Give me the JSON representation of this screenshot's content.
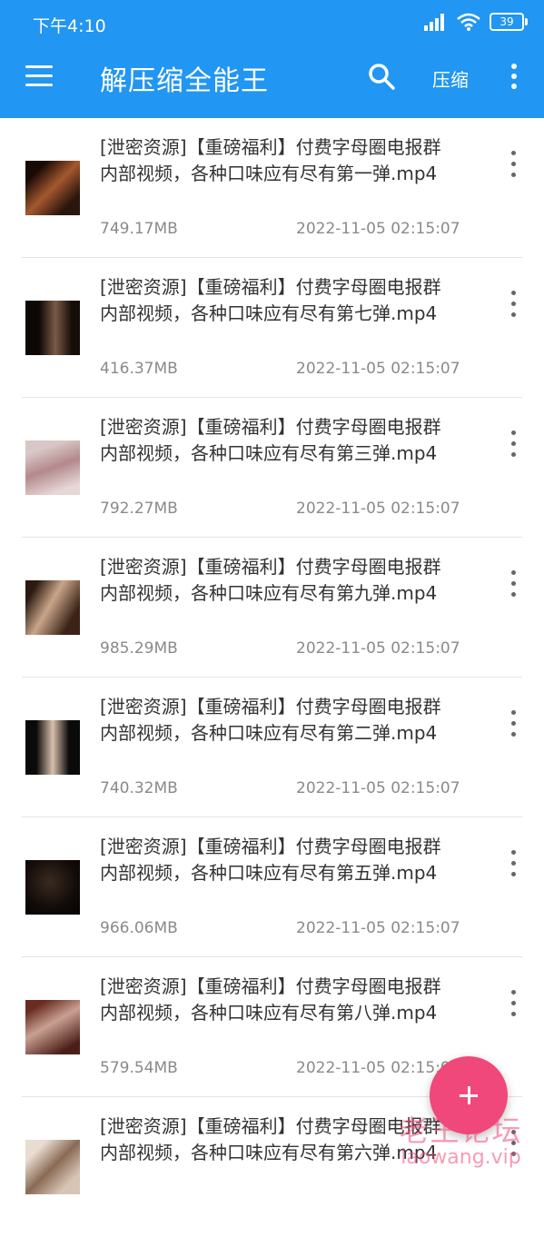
{
  "status_bar": {
    "time": "下午4:10",
    "battery": "39"
  },
  "app_bar": {
    "title": "解压缩全能王",
    "compress_label": "压缩"
  },
  "files": [
    {
      "title": "[泄密资源]【重磅福利】付费字母圈电报群内部视频，各种口味应有尽有第一弹.mp4",
      "size": "749.17MB",
      "date": "2022-11-05 02:15:07"
    },
    {
      "title": "[泄密资源]【重磅福利】付费字母圈电报群内部视频，各种口味应有尽有第七弹.mp4",
      "size": "416.37MB",
      "date": "2022-11-05 02:15:07"
    },
    {
      "title": "[泄密资源]【重磅福利】付费字母圈电报群内部视频，各种口味应有尽有第三弹.mp4",
      "size": "792.27MB",
      "date": "2022-11-05 02:15:07"
    },
    {
      "title": "[泄密资源]【重磅福利】付费字母圈电报群内部视频，各种口味应有尽有第九弹.mp4",
      "size": "985.29MB",
      "date": "2022-11-05 02:15:07"
    },
    {
      "title": "[泄密资源]【重磅福利】付费字母圈电报群内部视频，各种口味应有尽有第二弹.mp4",
      "size": "740.32MB",
      "date": "2022-11-05 02:15:07"
    },
    {
      "title": "[泄密资源]【重磅福利】付费字母圈电报群内部视频，各种口味应有尽有第五弹.mp4",
      "size": "966.06MB",
      "date": "2022-11-05 02:15:07"
    },
    {
      "title": "[泄密资源]【重磅福利】付费字母圈电报群内部视频，各种口味应有尽有第八弹.mp4",
      "size": "579.54MB",
      "date": "2022-11-05 02:15:07"
    },
    {
      "title": "[泄密资源]【重磅福利】付费字母圈电报群内部视频，各种口味应有尽有第六弹.mp4",
      "size": "",
      "date": ""
    }
  ],
  "watermark": {
    "line1": "老王论坛",
    "line2": "laowang.vip"
  },
  "colors": {
    "primary": "#2196F3",
    "fab": "#F0487A"
  },
  "icons": [
    "signal-icon",
    "wifi-icon",
    "battery-icon",
    "menu-icon",
    "search-icon",
    "more-vert-icon",
    "add-icon"
  ]
}
